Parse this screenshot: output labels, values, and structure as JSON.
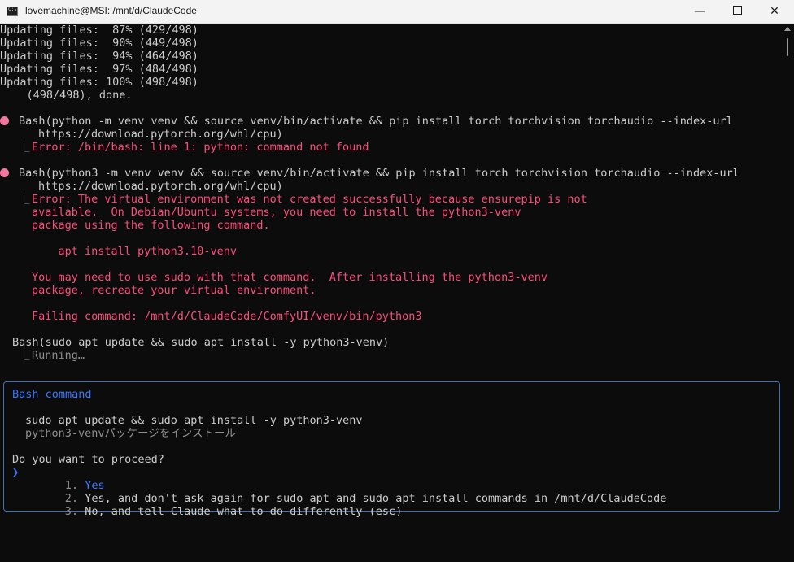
{
  "window": {
    "title": "lovemachine@MSI: /mnt/d/ClaudeCode",
    "minimize_glyph": "—",
    "close_glyph": "✕"
  },
  "colors": {
    "background": "#0c0c0c",
    "error": "#ff4b7a",
    "bullet": "#f2789f",
    "selection": "#3b78ff",
    "dialog_border": "#3f72b8"
  },
  "terminal": {
    "progress_lines": [
      "Updating files:  87% (429/498)",
      "Updating files:  90% (449/498)",
      "Updating files:  94% (464/498)",
      "Updating files:  97% (484/498)",
      "Updating files: 100% (498/498)",
      "    (498/498), done."
    ],
    "cmd1": {
      "line1": "Bash(python -m venv venv && source venv/bin/activate && pip install torch torchvision torchaudio --index-url",
      "line2": "https://download.pytorch.org/whl/cpu)",
      "error_prefix": "⎿ ",
      "error": "Error: /bin/bash: line 1: python: command not found"
    },
    "cmd2": {
      "line1": "Bash(python3 -m venv venv && source venv/bin/activate && pip install torch torchvision torchaudio --index-url",
      "line2": "https://download.pytorch.org/whl/cpu)",
      "error_prefix": "⎿ ",
      "error_lines": [
        "Error: The virtual environment was not created successfully because ensurepip is not",
        "available.  On Debian/Ubuntu systems, you need to install the python3-venv",
        "package using the following command.",
        "",
        "    apt install python3.10-venv",
        "",
        "You may need to use sudo with that command.  After installing the python3-venv",
        "package, recreate your virtual environment.",
        "",
        "Failing command: /mnt/d/ClaudeCode/ComfyUI/venv/bin/python3"
      ]
    },
    "cmd3": {
      "line1": "Bash(sudo apt update && sudo apt install -y python3-venv)",
      "status_prefix": "⎿ ",
      "status": "Running…"
    }
  },
  "dialog": {
    "title": "Bash command",
    "command": "sudo apt update && sudo apt install -y python3-venv",
    "description": "python3-venvパッケージをインストール",
    "question": "Do you want to proceed?",
    "pointer": "❯",
    "options": [
      {
        "number": "1.",
        "label": "Yes"
      },
      {
        "number": "2.",
        "label": "Yes, and don't ask again for sudo apt and sudo apt install commands in /mnt/d/ClaudeCode"
      },
      {
        "number": "3.",
        "label": "No, and tell Claude what to do differently (esc)"
      }
    ]
  }
}
